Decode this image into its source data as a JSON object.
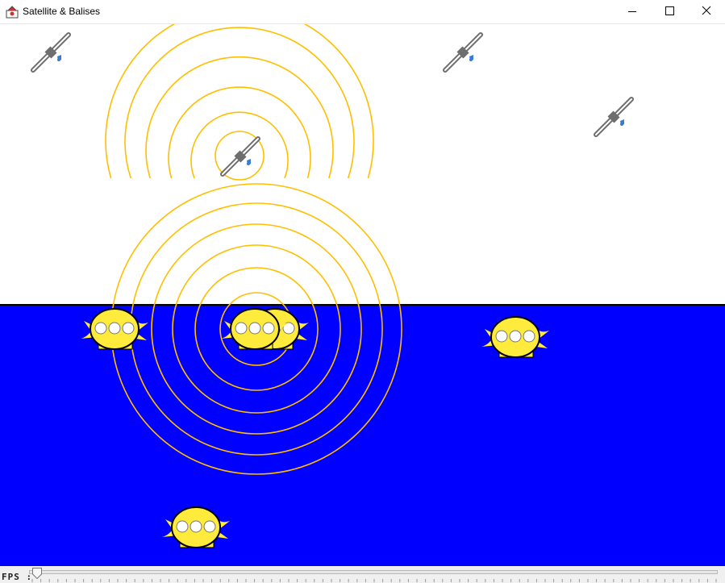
{
  "window": {
    "title": "Satellite & Balises",
    "icon": "java-app-icon"
  },
  "controls": {
    "minimize": "minimize-icon",
    "maximize": "maximize-icon",
    "close": "close-icon"
  },
  "scene": {
    "sky_color": "#ffffff",
    "sea_color": "#0000ff",
    "wave_color": "#ffbf00",
    "balise_color": "#ffeb3b"
  },
  "fps": {
    "label": "FPS :",
    "value_fraction": 0.0
  }
}
